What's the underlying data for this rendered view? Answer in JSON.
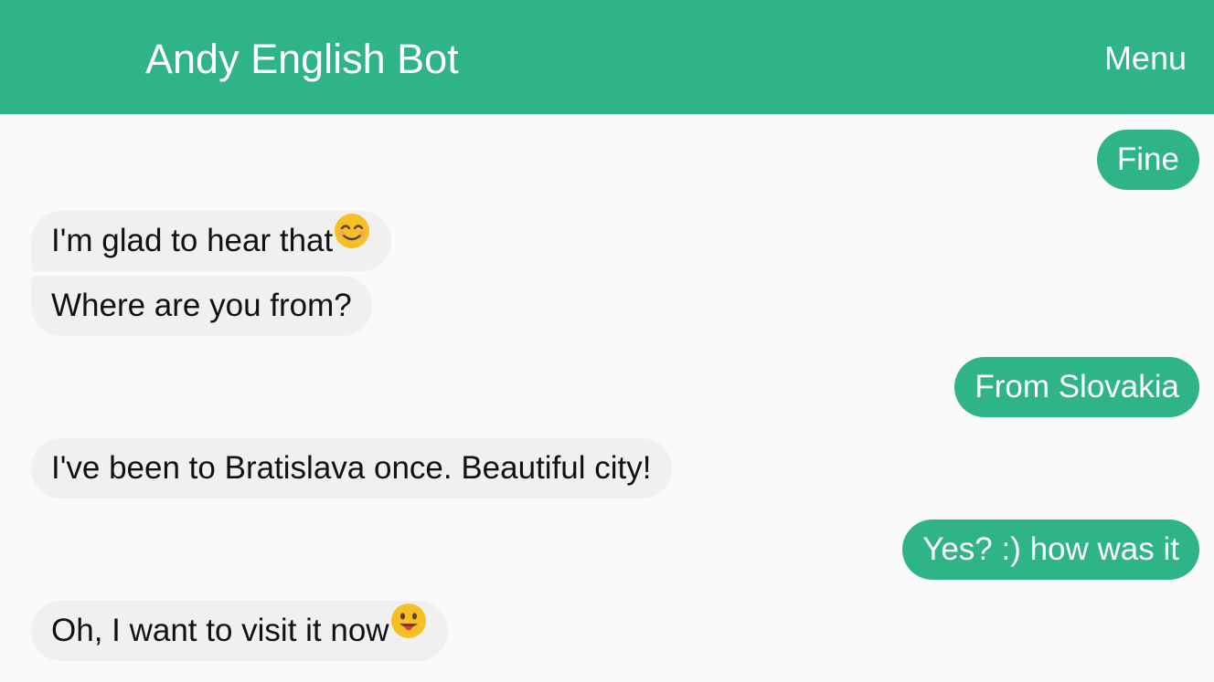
{
  "header": {
    "title": "Andy English Bot",
    "menu_label": "Menu",
    "background_color": "#2fb388"
  },
  "messages": [
    {
      "sender": "user",
      "text": "Fine"
    },
    {
      "sender": "bot",
      "text": "I'm glad to hear that",
      "emoji": "smiling-face-icon"
    },
    {
      "sender": "bot",
      "text": "Where are you from?"
    },
    {
      "sender": "user",
      "text": "From Slovakia"
    },
    {
      "sender": "bot",
      "text": "I've been to Bratislava once. Beautiful city!"
    },
    {
      "sender": "user",
      "text": "Yes? :) how was it"
    },
    {
      "sender": "bot",
      "text": "Oh, I want to visit it now",
      "emoji": "tongue-out-face-icon"
    }
  ],
  "colors": {
    "user_bubble": "#2fb388",
    "bot_bubble": "#f0f0f0",
    "emoji": "#f6bf26"
  }
}
